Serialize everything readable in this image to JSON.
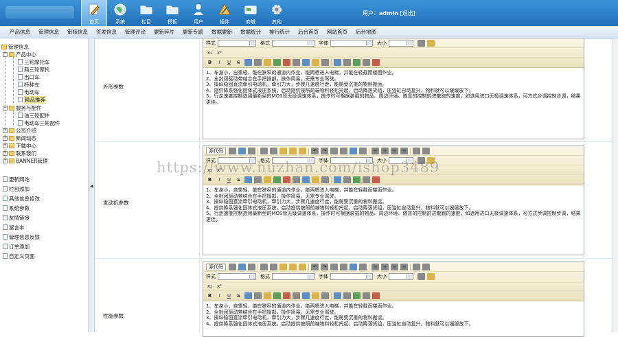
{
  "header": {
    "nav": [
      {
        "label": "首页",
        "icon": "pencil-icon"
      },
      {
        "label": "系统",
        "icon": "globe-icon"
      },
      {
        "label": "栏目",
        "icon": "folder-icon"
      },
      {
        "label": "模板",
        "icon": "folder-icon"
      },
      {
        "label": "用户",
        "icon": "user-icon"
      },
      {
        "label": "插件",
        "icon": "tools-icon"
      },
      {
        "label": "商城",
        "icon": "card-icon"
      },
      {
        "label": "其他",
        "icon": "gear-icon"
      }
    ],
    "user_prefix": "用户：",
    "username": "admin",
    "logout": "[退出]"
  },
  "subnav": [
    "产品信息",
    "管理信息",
    "审核信息",
    "签发信息",
    "管理评论",
    "更新碎片",
    "更新专题",
    "数据更新",
    "数据统计",
    "排行统计",
    "后台首页",
    "网站首页",
    "后台地图"
  ],
  "tree": {
    "root": "管理信息",
    "product_center": "产品中心",
    "products": [
      "三轮摩托车",
      "两三轮摩托",
      "出口车",
      "特种车",
      "电动车",
      "精品推荐"
    ],
    "service": "服务与配件",
    "service_items": [
      "油三轮配件",
      "电动车三轮配件"
    ],
    "others": [
      "公司介绍",
      "新闻动态",
      "下载中心",
      "联系我们",
      "BANNER管理"
    ],
    "tools": [
      "更新网站",
      "栏目添加",
      "其他信息修改",
      "系统参数",
      "友情链接",
      "留言本",
      "管理信息反馈",
      "订单添加",
      "自定义页面"
    ]
  },
  "fields": [
    {
      "label": "外形参数",
      "content": [
        "1、车身小，自重轻，能在狭窄的通道内作业，能两栖进入电梯，并能在轻载而楼面作业。",
        "2、全封闭驱动带结合在手把操部，操作简易，无需专业驾驶。",
        "3、操纵稳固直流牵引电动机，牵引力大，步骤几速度行走，能爬受沉重的物料搬运。",
        "4、提供降系强化固体式液压系统，启动提供按照前端物料轻松托起，启动降落货组，压油缸自动复兴，物料就可以缓缓放下。",
        "5、行走速度控制选用最新型的MOS管无级调速体系，操作时可根据装载的物品、周边环境、随意的控制前进散跑的速度，如选用进口无极调速体系，可方式步调控制步调，结果更佳。"
      ]
    },
    {
      "label": "发动机参数",
      "content": [
        "1、车身小，自重轻，能在狭窄的通道内作业，能两栖进入电梯，并能在轻载而楼面作业。",
        "2、全封闭驱动带结合在手把操部，操作简易，无需专业驾驶。",
        "3、操纵稳固直流牵引电动机，牵引力大，步骤几速度行走，能爬受沉重的物料搬运。",
        "4、提供降系强化固体式液压系统，启动提供按照前端物料轻松托起，启动降落货组，压油缸自动复兴，物料就可以缓缓放下。",
        "5、行走速度控制选用最新型的MOS管无级调速体系，操作时可根据装载的物品、周边环境、随意的控制前进散跑的速度，如选用进口无极调速体系，可方式步调控制步调，结果更佳。"
      ]
    },
    {
      "label": "性能参数",
      "content": [
        "1、车身小，自重轻，能在狭窄的通道内作业，能两栖进入电梯，并能在轻载而楼面作业。",
        "2、全封闭驱动带结合在手把操部，操作简易，无需专业驾驶。",
        "3、操纵稳固直流牵引电动机，牵引力大，步骤几速度行走，能爬受沉重的物料搬运。",
        "4、提供降系强化固体式液压系统，启动提供按照前端物料轻松托起，启动降落货组，压油缸自动复兴，物料就可以缓缓放下。"
      ]
    }
  ],
  "editor": {
    "source_label": "源代码",
    "style_label": "样式",
    "format_label": "格式",
    "font_label": "字体",
    "size_label": "大小"
  },
  "watermark": "https://www.huzhan.com/ishop3489"
}
